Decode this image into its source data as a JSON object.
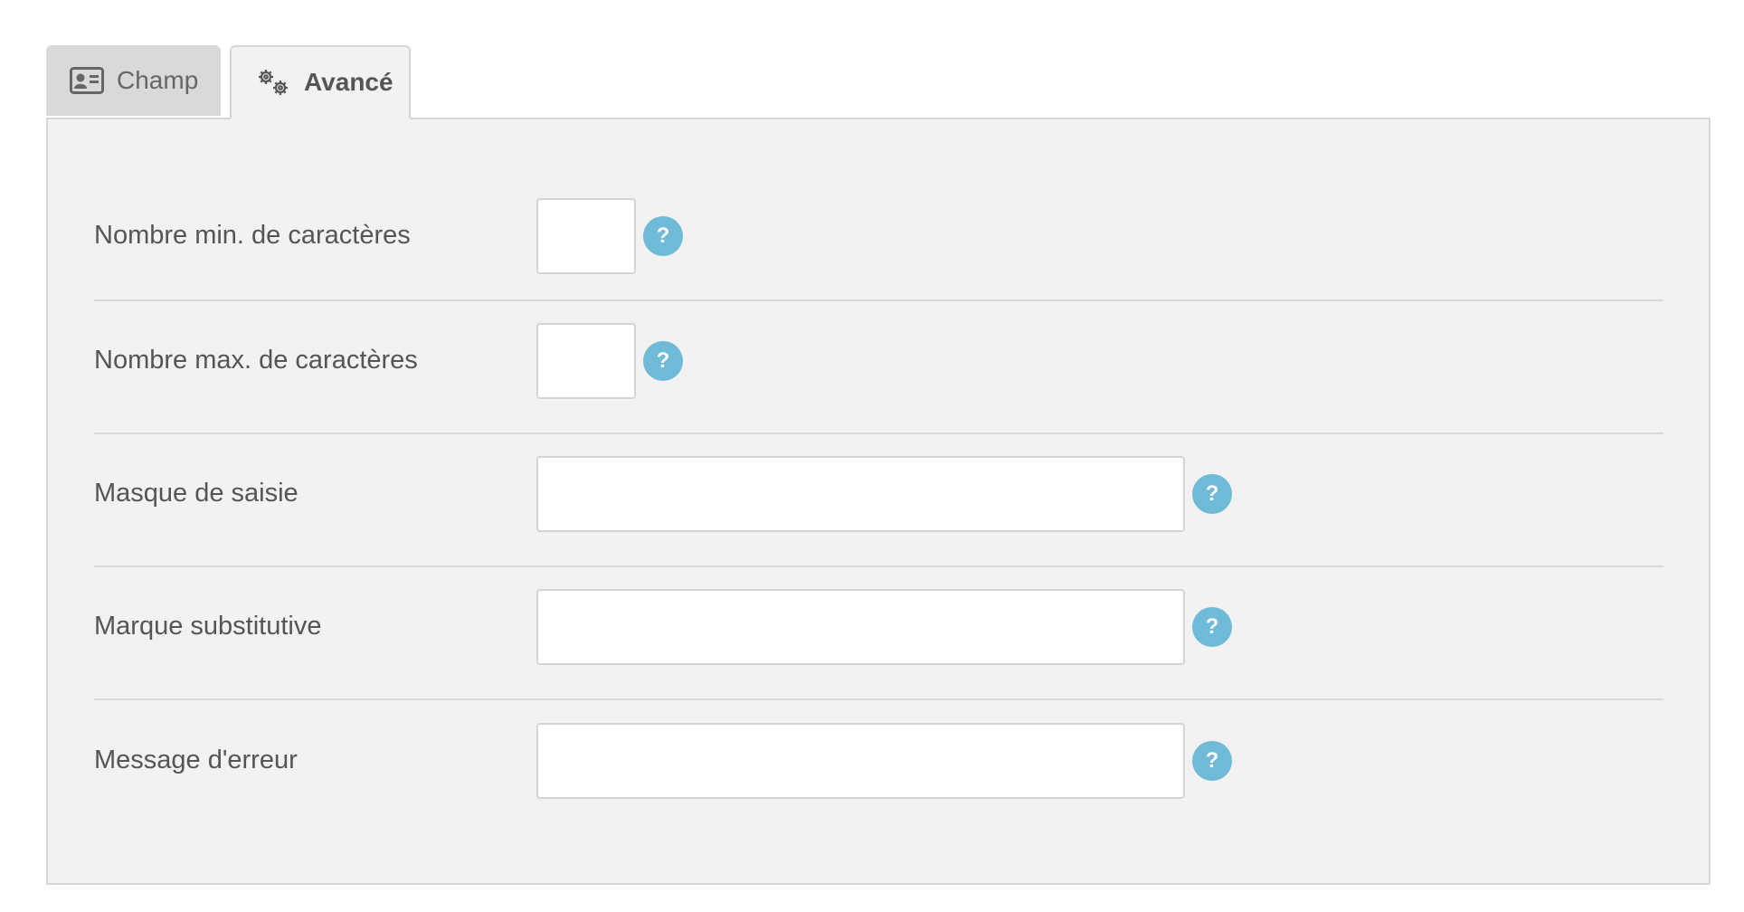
{
  "tabs": [
    {
      "label": "Champ",
      "icon": "id-card-icon",
      "active": false
    },
    {
      "label": "Avancé",
      "icon": "gears-icon",
      "active": true
    }
  ],
  "fields": [
    {
      "label": "Nombre min. de caractères",
      "value": "",
      "help": "?"
    },
    {
      "label": "Nombre max. de caractères",
      "value": "",
      "help": "?"
    },
    {
      "label": "Masque de saisie",
      "value": "",
      "help": "?"
    },
    {
      "label": "Marque substitutive",
      "value": "",
      "help": "?"
    },
    {
      "label": "Message d'erreur",
      "value": "",
      "help": "?"
    }
  ],
  "colors": {
    "panel_bg": "#f2f2f2",
    "inactive_tab_bg": "#d9d9d9",
    "help_badge": "#6fbad6",
    "text": "#555555"
  }
}
